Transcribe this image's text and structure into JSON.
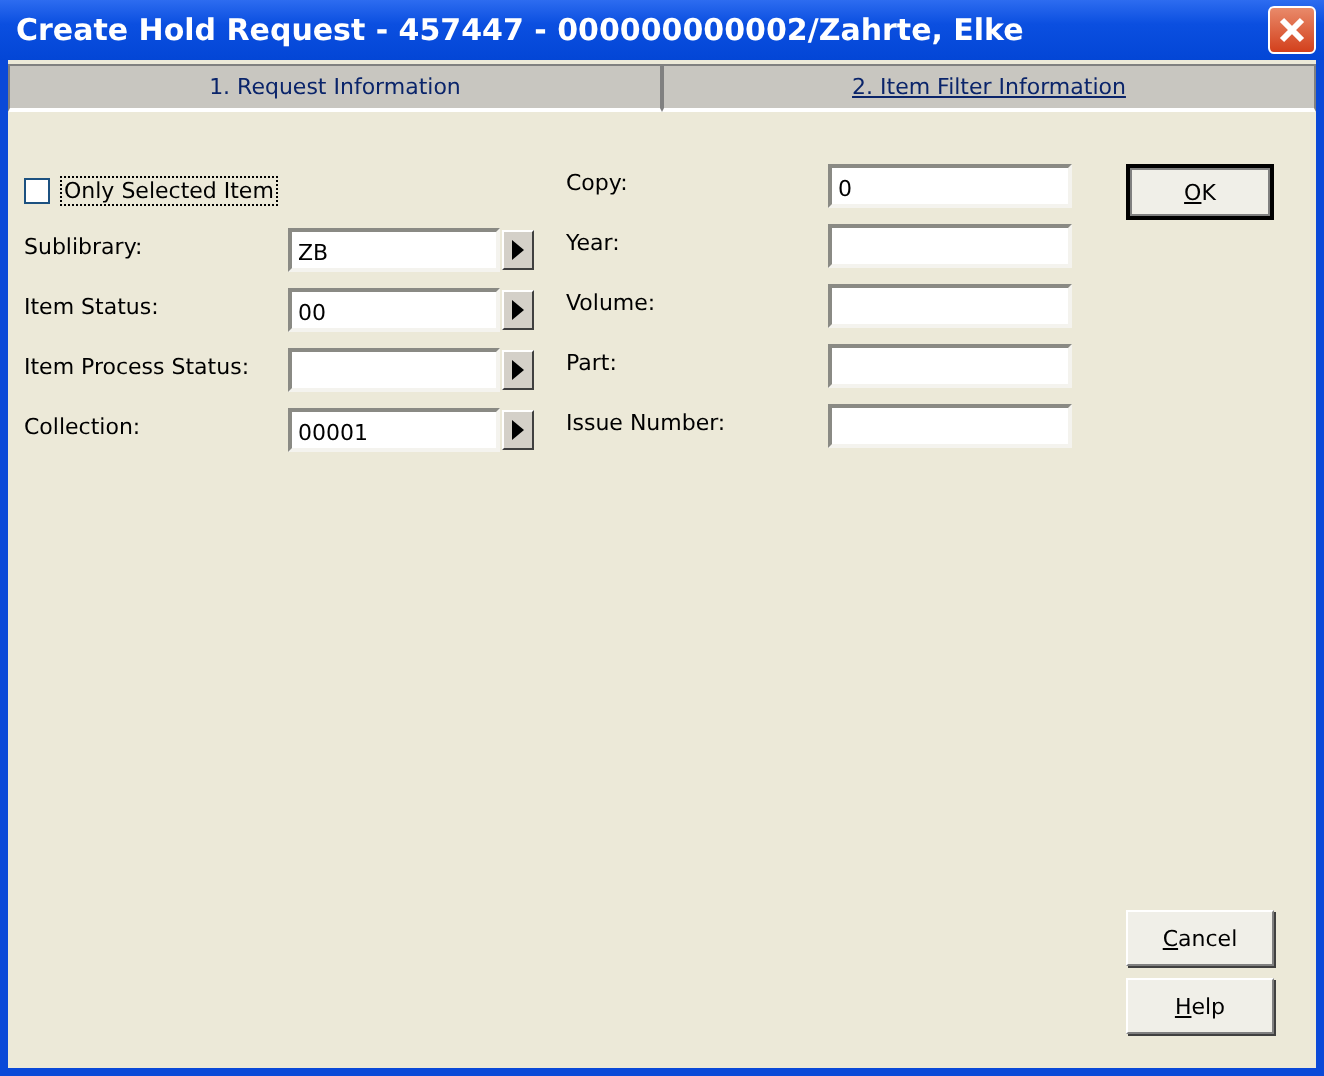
{
  "window": {
    "title": "Create Hold Request - 457447 - 000000000002/Zahrte, Elke"
  },
  "tabs": [
    {
      "label": "1. Request Information",
      "selected": false
    },
    {
      "label": "2. Item Filter Information",
      "selected": true
    }
  ],
  "only_selected_item": {
    "label": "Only Selected Item",
    "checked": false
  },
  "left_fields": [
    {
      "label": "Sublibrary:",
      "value": "ZB"
    },
    {
      "label": "Item Status:",
      "value": "00"
    },
    {
      "label": "Item Process Status:"
    },
    {
      "label": "Collection:",
      "value": "00001"
    }
  ],
  "right_fields": [
    {
      "label": "Copy:",
      "value": "0"
    },
    {
      "label": "Year:"
    },
    {
      "label": "Volume:"
    },
    {
      "label": "Part:"
    },
    {
      "label": "Issue Number:"
    }
  ],
  "buttons": [
    {
      "label": "OK",
      "kind": "default"
    },
    {
      "label": "Cancel",
      "kind": "normal"
    },
    {
      "label": "Help",
      "kind": "normal"
    }
  ]
}
